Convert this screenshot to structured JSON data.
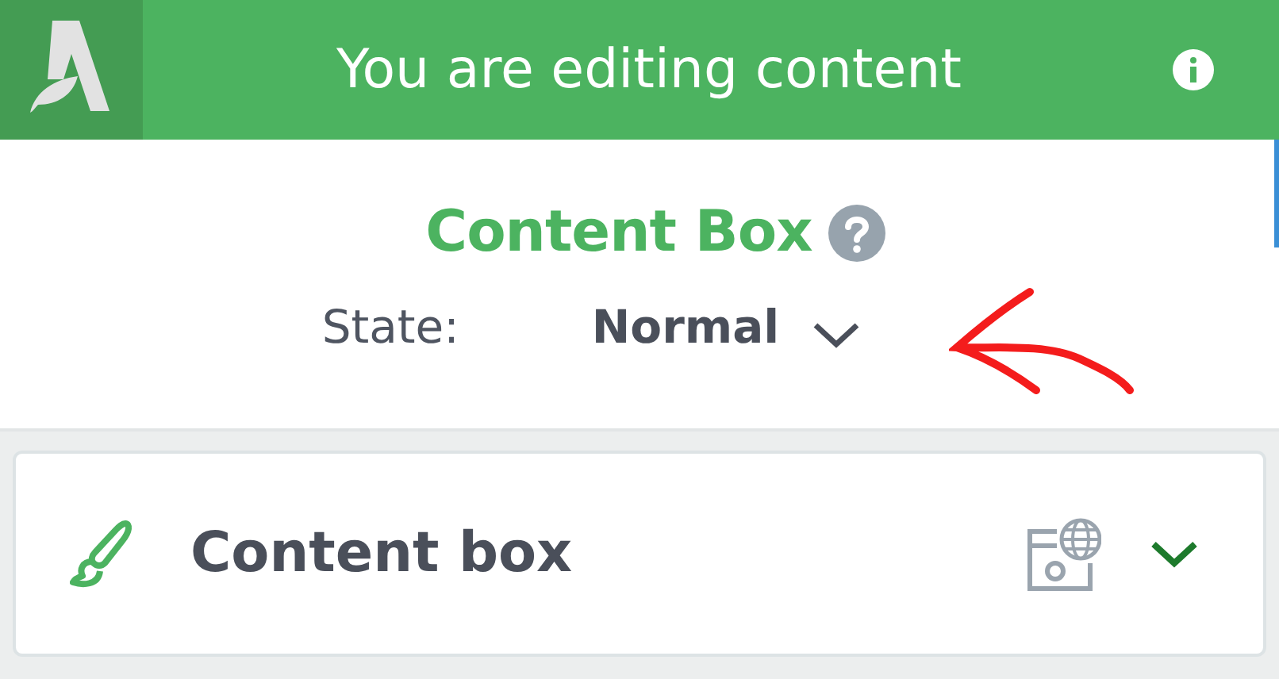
{
  "header": {
    "title": "You are editing content"
  },
  "panel": {
    "title": "Content Box",
    "state_label": "State:",
    "state_value": "Normal"
  },
  "card": {
    "title": "Content box",
    "expanded": false
  }
}
